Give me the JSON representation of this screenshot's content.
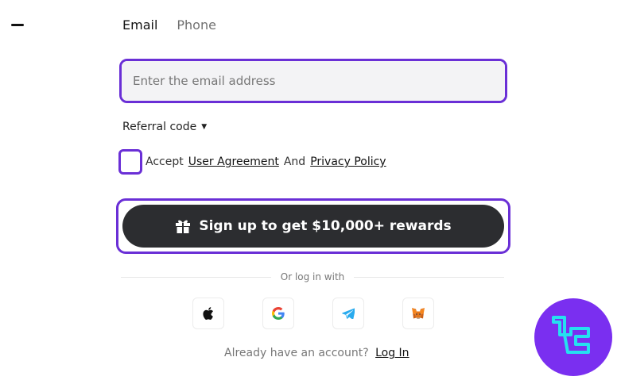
{
  "tabs": [
    {
      "label": "Email",
      "active": true
    },
    {
      "label": "Phone",
      "active": false
    }
  ],
  "email_field": {
    "placeholder": "Enter the email address",
    "value": ""
  },
  "referral": {
    "label": "Referral code"
  },
  "agreement": {
    "checked": false,
    "prefix": "Accept",
    "link1": "User Agreement",
    "conj": "And",
    "link2": "Privacy Policy"
  },
  "signup": {
    "label": "Sign up to get $10,000+ rewards"
  },
  "divider": {
    "label": "Or log in with"
  },
  "social_logins": [
    {
      "name": "apple-icon"
    },
    {
      "name": "google-icon"
    },
    {
      "name": "telegram-icon"
    },
    {
      "name": "metamask-icon"
    }
  ],
  "login": {
    "prompt": "Already have an account?",
    "link": "Log In"
  },
  "colors": {
    "accent": "#6a2fd6",
    "button": "#2c2d30",
    "logo_bg": "#7a2ff0",
    "logo_fg": "#25e0f0"
  }
}
